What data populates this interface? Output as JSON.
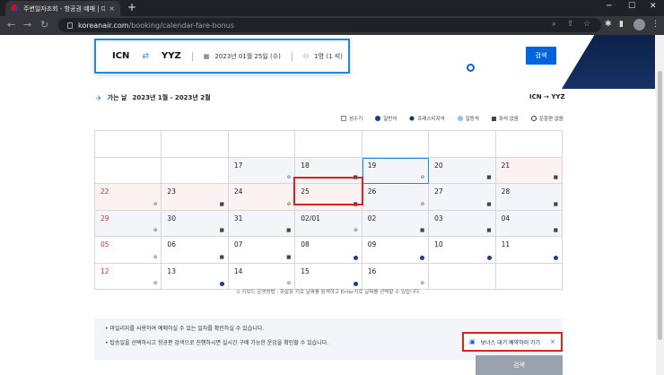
{
  "browser": {
    "tab_title": "주변일자조회 - 항공권 예매 | 대한",
    "tab_close": "×",
    "new_tab": "+",
    "url_host": "koreanair.com",
    "url_path": "/booking/calendar-fare-bonus",
    "window_min": "─",
    "window_max": "☐",
    "window_close": "✕"
  },
  "search": {
    "origin": "ICN",
    "destination": "YYZ",
    "date": "2023년 01월 25일 (수)",
    "passengers": "1명 (1 석)",
    "button": "검색"
  },
  "calendar": {
    "title_label": "가는 날",
    "period": "2023년 1월 - 2023년 2월",
    "route": "ICN  →  YYZ",
    "legend": [
      "성수기",
      "일반석",
      "프레스티지석",
      "일등석",
      "좌석 없음",
      "운항편 없음"
    ],
    "rows": [
      [
        {
          "d": ""
        },
        {
          "d": ""
        },
        {
          "d": ""
        },
        {
          "d": ""
        },
        {
          "d": ""
        },
        {
          "d": ""
        },
        {
          "d": ""
        }
      ],
      [
        {
          "d": ""
        },
        {
          "d": ""
        },
        {
          "d": "17",
          "s": "⊘"
        },
        {
          "d": "18",
          "s": "■"
        },
        {
          "d": "19",
          "s": "⊘"
        },
        {
          "d": "20",
          "s": "■"
        },
        {
          "d": "21",
          "s": "■"
        }
      ],
      [
        {
          "d": "22",
          "s": "⊘"
        },
        {
          "d": "23",
          "s": "■"
        },
        {
          "d": "24",
          "s": "⊘"
        },
        {
          "d": "25",
          "s": "■"
        },
        {
          "d": "26",
          "s": "⊘"
        },
        {
          "d": "27",
          "s": "■"
        },
        {
          "d": "28",
          "s": "■"
        }
      ],
      [
        {
          "d": "29",
          "s": "⊘"
        },
        {
          "d": "30",
          "s": "■"
        },
        {
          "d": "31",
          "s": "■"
        },
        {
          "d": "02/01",
          "s": "⊘"
        },
        {
          "d": "02",
          "s": "■"
        },
        {
          "d": "03",
          "s": "■"
        },
        {
          "d": "04",
          "s": "■"
        }
      ],
      [
        {
          "d": "05",
          "s": "⊘"
        },
        {
          "d": "06",
          "s": "■"
        },
        {
          "d": "07",
          "s": "■"
        },
        {
          "d": "08",
          "s": "●"
        },
        {
          "d": "09",
          "s": "●"
        },
        {
          "d": "10",
          "s": "●"
        },
        {
          "d": "11",
          "s": "●"
        }
      ],
      [
        {
          "d": "12",
          "s": "⊘"
        },
        {
          "d": "13",
          "s": "●"
        },
        {
          "d": "14",
          "s": "⊘"
        },
        {
          "d": "15",
          "s": "●"
        },
        {
          "d": "16",
          "s": "⊘"
        },
        {
          "d": ""
        },
        {
          "d": ""
        }
      ]
    ],
    "keyboard_note": "⊙ 키보드 운영방법 : 화살표 키로 날짜를 탐색하고 Enter키로 날짜를 선택할 수 있습니다."
  },
  "info": {
    "line1": "• 마일리지를 사용하여 예매하실 수 있는 일자를 확인하실 수 있습니다.",
    "line2": "• 탑승일을 선택하시고 항공편 검색으로 진행하시면 실시간 구매 가능한 운임을 확인할 수 있습니다."
  },
  "bonus_waitlist": {
    "icon": "bonus-icon",
    "label": "보너스 대기 예약하러 가기",
    "close": "×"
  },
  "bottom_button": "검색",
  "colors": {
    "brand_blue": "#0064de",
    "highlight_red": "#e02020",
    "navy": "#0b2148"
  }
}
